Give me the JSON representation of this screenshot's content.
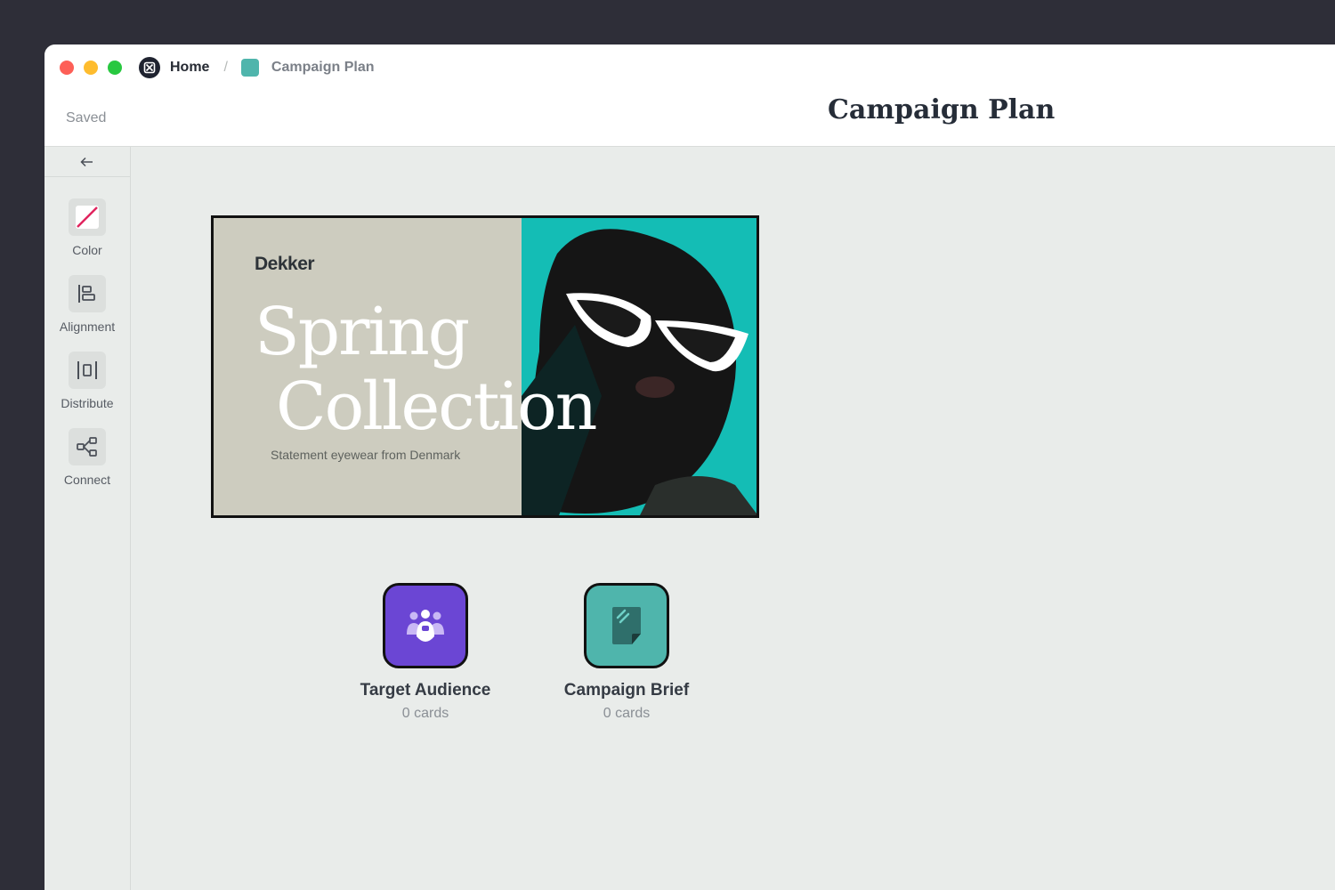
{
  "breadcrumb": {
    "home_label": "Home",
    "separator": "/",
    "current_label": "Campaign Plan",
    "current_color": "#4fb5ac"
  },
  "status": {
    "saved_label": "Saved"
  },
  "page": {
    "title": "Campaign Plan"
  },
  "sidebar": {
    "collapse_icon": "arrow-left-icon",
    "tools": [
      {
        "label": "Color",
        "icon": "color-slash-icon"
      },
      {
        "label": "Alignment",
        "icon": "align-left-icon"
      },
      {
        "label": "Distribute",
        "icon": "distribute-icon"
      },
      {
        "label": "Connect",
        "icon": "connect-icon"
      }
    ]
  },
  "hero_card": {
    "brand": "Dekker",
    "headline_line1": "Spring",
    "headline_line2": "Collection",
    "tagline": "Statement eyewear from Denmark",
    "left_color": "#cdccbf",
    "right_color": "#16bcb5"
  },
  "boards": [
    {
      "title": "Target Audience",
      "count": "0 cards",
      "color": "#6b46d4",
      "icon": "people-icon"
    },
    {
      "title": "Campaign Brief",
      "count": "0 cards",
      "color": "#4fb5ac",
      "icon": "document-icon"
    }
  ]
}
